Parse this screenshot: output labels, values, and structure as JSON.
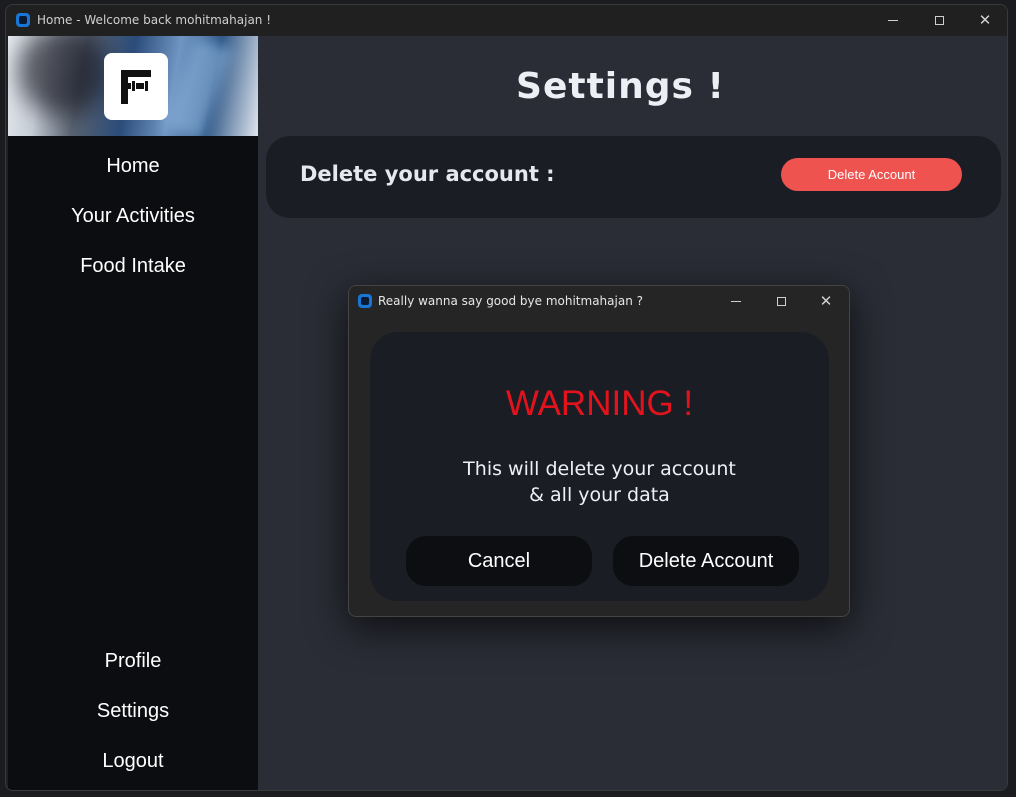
{
  "window": {
    "title": "Home - Welcome back mohitmahajan !",
    "controls": {
      "minimize": "minimize",
      "maximize": "maximize",
      "close": "✕"
    }
  },
  "sidebar": {
    "logo_icon": "dumbbell-f-logo-icon",
    "top_items": [
      {
        "label": "Home"
      },
      {
        "label": "Your Activities"
      },
      {
        "label": "Food Intake"
      }
    ],
    "bottom_items": [
      {
        "label": "Profile"
      },
      {
        "label": "Settings"
      },
      {
        "label": "Logout"
      }
    ]
  },
  "main": {
    "title": "Settings !",
    "delete_card": {
      "label": "Delete your account :",
      "button_label": "Delete Account",
      "button_color": "#ef5350"
    }
  },
  "dialog": {
    "title": "Really wanna say good bye mohitmahajan ?",
    "close": "✕",
    "warning": "WARNING !",
    "message_line1": "This will delete your account",
    "message_line2": "& all your data",
    "cancel_label": "Cancel",
    "confirm_label": "Delete Account",
    "warning_color": "#e3131e"
  },
  "colors": {
    "app_icon": "#1877d6",
    "sidebar_bg": "#0c0d10",
    "content_bg": "#2a2d36",
    "card_bg": "#1b1d24"
  }
}
